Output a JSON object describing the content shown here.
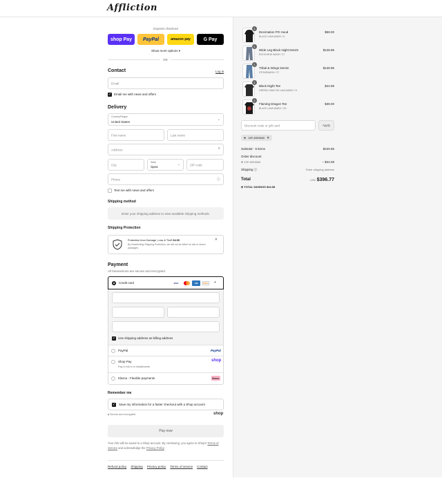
{
  "header": {
    "logo": "Affliction"
  },
  "express": {
    "title": "Express checkout",
    "buttons": [
      {
        "label": "shop Pay",
        "bg": "#5a31f4",
        "fg": "#ffffff"
      },
      {
        "label": "PayPal",
        "bg": "#ffc439",
        "fg": "#003087"
      },
      {
        "label": "amazon pay",
        "bg": "#ffd814",
        "fg": "#111111"
      },
      {
        "label": "G Pay",
        "bg": "#000000",
        "fg": "#ffffff"
      }
    ],
    "more": "Show more options",
    "or": "OR"
  },
  "contact": {
    "title": "Contact",
    "login": "Log in",
    "email_placeholder": "Email",
    "newsletter": "Email me with news and offers"
  },
  "delivery": {
    "title": "Delivery",
    "country_label": "Country/Region",
    "country": "United States",
    "first_name": "First name",
    "last_name": "Last name",
    "address": "Address",
    "city": "City",
    "state_label": "State",
    "state": "Spea",
    "zip": "ZIP code",
    "phone": "Phone",
    "text_me": "Text me with news and offers"
  },
  "shipping": {
    "title": "Shipping method",
    "note": "Enter your shipping address to view available shipping methods."
  },
  "protection": {
    "title": "Shipping Protection",
    "line1": "Protection from Damage, Loss & Theft",
    "price": "$4.59",
    "line2": "By Deselecting Shipping Protection, we will not be liable for lost or stolen packages."
  },
  "payment": {
    "title": "Payment",
    "subtitle": "All transactions are secure and encrypted.",
    "credit_card": "Credit card",
    "more_cards": "+",
    "billing_same": "Use shipping address as billing address",
    "paypal": "PayPal",
    "shoppay": "Shop Pay",
    "shoppay_sub": "Pay in full or in installments",
    "klarna": "Klarna - Flexible payments",
    "klarna_badge": "Klarna."
  },
  "remember": {
    "title": "Remember me",
    "save_info": "Save my information for a faster checkout with a Shop account",
    "secure": "Secure and encrypted",
    "shop": "shop"
  },
  "pay_now": "Pay now",
  "legal": {
    "text1": "Your info will be saved to a Shop account. By continuing, you agree to Shop's",
    "terms": "Terms of Service",
    "text2": "and acknowledge the",
    "privacy": "Privacy Policy",
    "end": "."
  },
  "footer": [
    "Refund policy",
    "Shipping",
    "Privacy policy",
    "Terms of service",
    "Contact"
  ],
  "cart": {
    "items": [
      {
        "name": "Decimation PO Hood",
        "variant": "BLACK LAVA WASH / S",
        "price": "$59.00",
        "qty": "1"
      },
      {
        "name": "Wide Leg Black Night Denim",
        "variant": "ROCKVIEW WASH / 27",
        "price": "$128.95",
        "qty": "1"
      },
      {
        "name": "Tribal & Wings Denim",
        "variant": "STONEWASH / 27",
        "price": "$128.95",
        "qty": "1"
      },
      {
        "name": "Black Night Tee",
        "variant": "GREEN CAMO W/ LAVA WASH / S",
        "price": "$44.95",
        "qty": "1"
      },
      {
        "name": "Flaming Dragon Tee",
        "variant": "BLACK LAVA WASH / XS",
        "price": "$39.00",
        "qty": "1"
      }
    ],
    "discount_placeholder": "Discount code or gift card",
    "apply": "Apply",
    "applied_code": "13P-6993560",
    "subtotal_label": "Subtotal · 5 items",
    "subtotal": "$440.85",
    "order_discount": "Order discount",
    "discount_code": "13P-6993560",
    "discount_value": "− $44.08",
    "shipping_label": "Shipping",
    "shipping_value": "Enter shipping address",
    "total_label": "Total",
    "currency": "USD",
    "total": "$396.77",
    "savings_label": "TOTAL SAVINGS",
    "savings": "$44.08"
  }
}
